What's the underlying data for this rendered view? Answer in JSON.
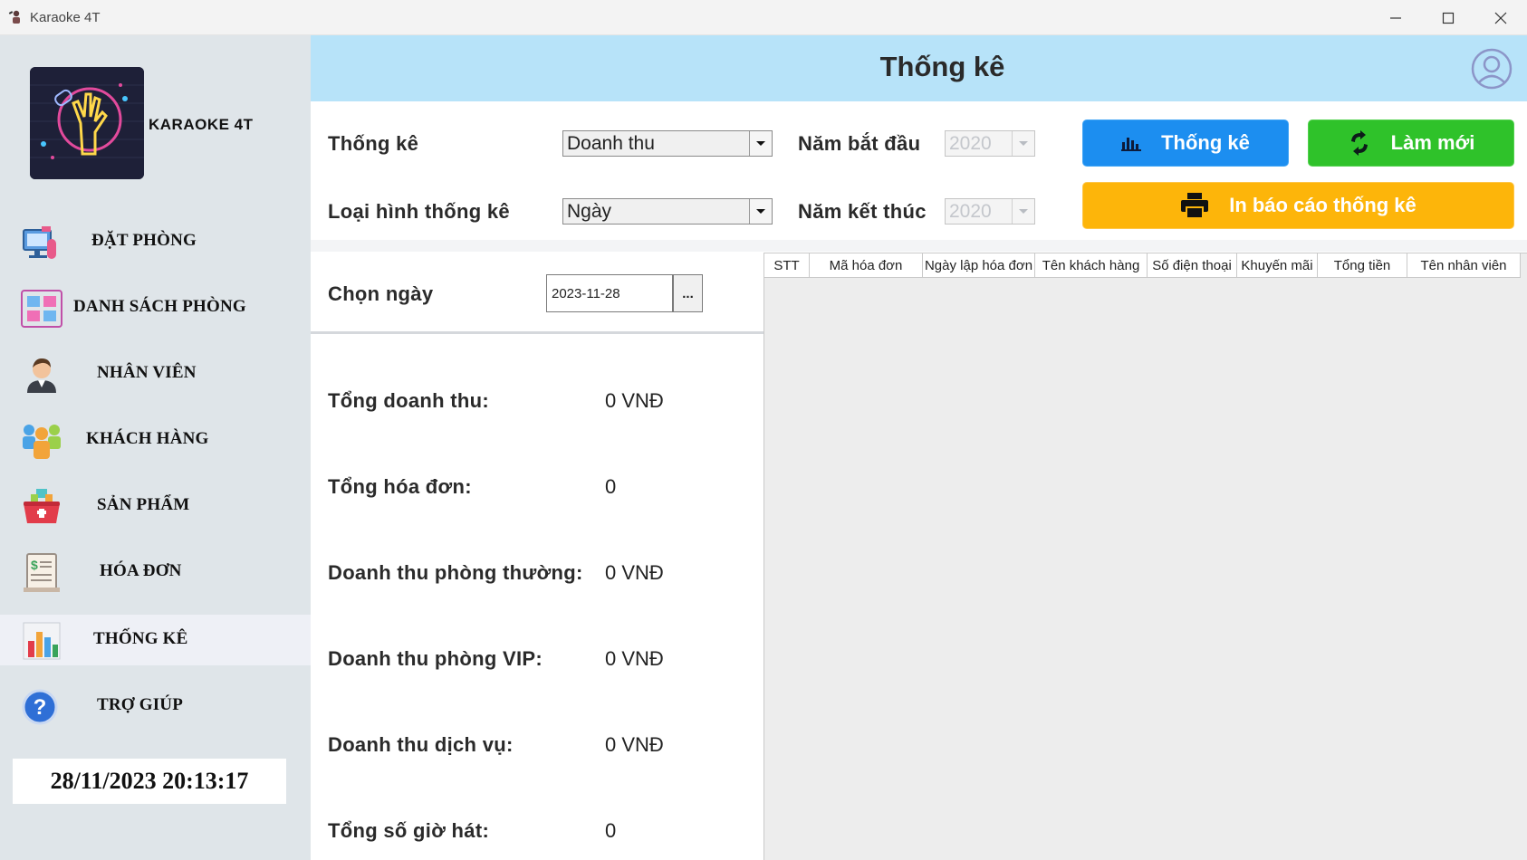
{
  "window": {
    "title": "Karaoke 4T"
  },
  "sidebar": {
    "brand": "KARAOKE 4T",
    "items": [
      {
        "label": "ĐẶT PHÒNG",
        "icon": "booking-icon"
      },
      {
        "label": "DANH SÁCH PHÒNG",
        "icon": "room-list-icon"
      },
      {
        "label": "NHÂN VIÊN",
        "icon": "employee-icon"
      },
      {
        "label": "KHÁCH HÀNG",
        "icon": "customers-icon"
      },
      {
        "label": "SẢN PHẨM",
        "icon": "products-icon"
      },
      {
        "label": "HÓA ĐƠN",
        "icon": "invoice-icon"
      },
      {
        "label": "THỐNG KÊ",
        "icon": "statistics-icon",
        "active": true
      },
      {
        "label": "TRỢ GIÚP",
        "icon": "help-icon"
      }
    ],
    "clock": "28/11/2023 20:13:17"
  },
  "header": {
    "title": "Thống kê"
  },
  "filters": {
    "stat_label": "Thống kê",
    "stat_value": "Doanh thu",
    "type_label": "Loại hình thống kê",
    "type_value": "Ngày",
    "start_year_label": "Năm bắt đầu",
    "start_year_value": "2020",
    "end_year_label": "Năm kết thúc",
    "end_year_value": "2020",
    "date_label": "Chọn ngày",
    "date_value": "2023-11-28",
    "date_button": "..."
  },
  "buttons": {
    "stats": "Thống kê",
    "refresh": "Làm mới",
    "print": "In báo cáo thống kê"
  },
  "colors": {
    "stats_button": "#1c8ef0",
    "refresh_button": "#2fc22a",
    "print_button": "#fdb50a",
    "header_bg": "#b7e3f9",
    "sidebar_bg": "#dfe5e9"
  },
  "summary": [
    {
      "label": "Tổng doanh thu:",
      "value": "0 VNĐ"
    },
    {
      "label": "Tổng hóa đơn:",
      "value": "0"
    },
    {
      "label": "Doanh thu phòng thường:",
      "value": "0 VNĐ"
    },
    {
      "label": "Doanh thu phòng VIP:",
      "value": "0 VNĐ"
    },
    {
      "label": "Doanh thu dịch vụ:",
      "value": "0 VNĐ"
    },
    {
      "label": "Tổng số giờ hát:",
      "value": "0"
    }
  ],
  "table": {
    "columns": [
      "STT",
      "Mã hóa đơn",
      "Ngày lập hóa đơn",
      "Tên khách hàng",
      "Số điện thoại",
      "Khuyến mãi",
      "Tổng tiền",
      "Tên nhân viên"
    ],
    "rows": []
  }
}
